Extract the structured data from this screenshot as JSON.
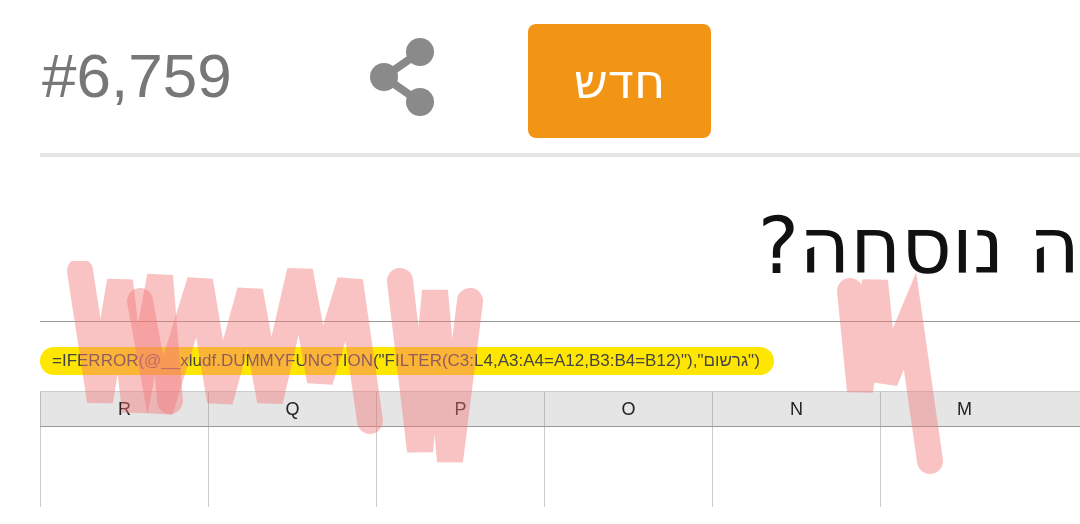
{
  "header": {
    "count": "#6,759",
    "new_button": "חדש"
  },
  "question": {
    "title": "ה נוסחה?"
  },
  "spreadsheet": {
    "formula": "=IFERROR(@__xludf.DUMMYFUNCTION(\"FILTER(C3:L4,A3:A4=A12,B3:B4=B12)\"),\"גרשום\")",
    "columns": [
      "M",
      "N",
      "O",
      "P",
      "Q",
      "R"
    ]
  }
}
